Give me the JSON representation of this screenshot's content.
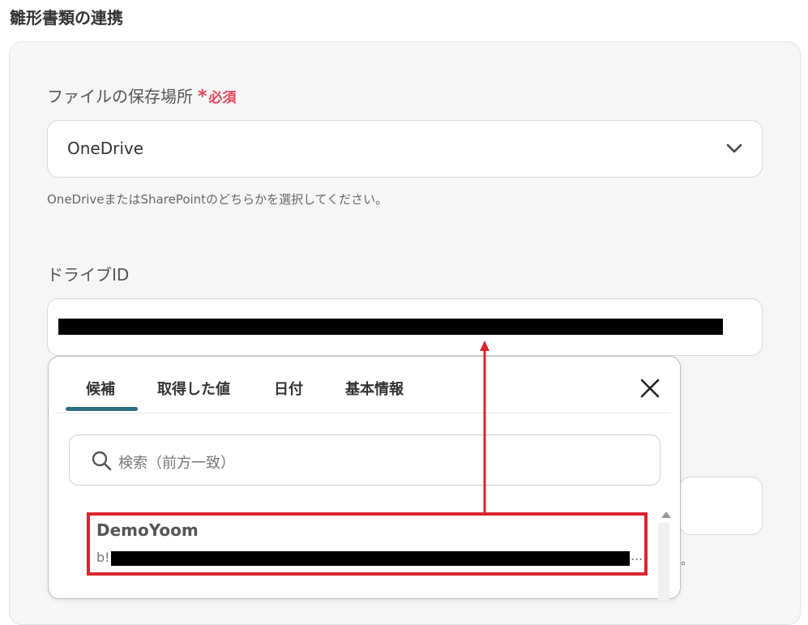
{
  "section": {
    "title": "雛形書類の連携"
  },
  "storage_field": {
    "label": "ファイルの保存場所",
    "required_star": "*",
    "required_text": "必須",
    "selected_value": "OneDrive",
    "help_text": "OneDriveまたはSharePointのどちらかを選択してください。"
  },
  "drive_field": {
    "label": "ドライブID",
    "value_redacted": true
  },
  "popup": {
    "tabs": [
      {
        "label": "候補"
      },
      {
        "label": "取得した値"
      },
      {
        "label": "日付"
      },
      {
        "label": "基本情報"
      }
    ],
    "active_tab": "候補",
    "search_placeholder": "検索（前方一致）",
    "items": [
      {
        "title": "DemoYoom",
        "sub_prefix": "b!",
        "sub_suffix": "..."
      }
    ]
  },
  "hidden_help_tail": "。",
  "colors": {
    "required": "#e5445a",
    "tab_active": "#2d6e7e",
    "highlight": "#d9262f"
  }
}
